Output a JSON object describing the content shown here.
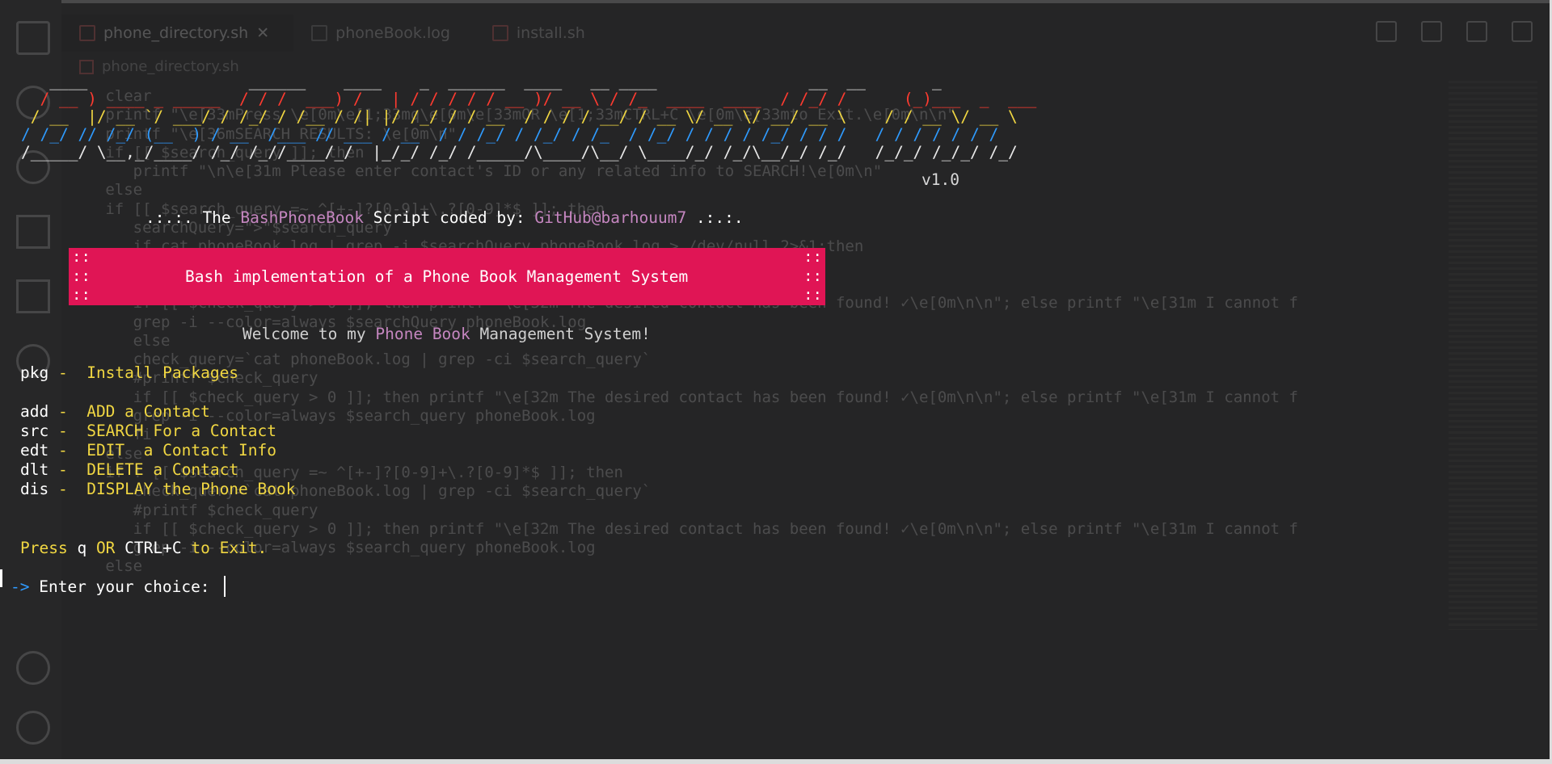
{
  "editor": {
    "tabs": [
      {
        "label": "phone_directory.sh",
        "close": "✕"
      },
      {
        "label": "phoneBook.log"
      },
      {
        "label": "install.sh"
      }
    ],
    "breadcrumb": "phone_directory.sh",
    "code_lines": [
      {
        "n": "",
        "t": "   clear"
      },
      {
        "n": "",
        "t": "   printf \"\\e[33mPress \\e[0m\\e[1;33mq\\e[0m\\e[33mOR \\e[1;33mCTRL+C \\e[0m\\e[33mto Exit.\\e[0m\\n\\n\""
      },
      {
        "n": "",
        "t": "   printf \"\\e[36mSEARCH RESULTS: \\e[0m\\n\""
      },
      {
        "n": "",
        "t": "   if [[ $search_query ]]; then"
      },
      {
        "n": "",
        "t": "      printf \"\\n\\e[31m Please enter contact's ID or any related info to SEARCH!\\e[0m\\n\""
      },
      {
        "n": "",
        "t": "   else"
      },
      {
        "n": "",
        "t": "   if [[ $search_query =~ ^[+-]?[0-9]+\\.?[0-9]*$ ]]; then"
      },
      {
        "n": "",
        "t": "      searchQuery=\">\"$search_query"
      },
      {
        "n": "",
        "t": "      if cat phoneBook.log | grep -i $searchQuery phoneBook.log > /dev/null 2>&1;then"
      },
      {
        "n": "",
        "t": "      check_query=`cat phoneBook.log | grep -ci $searchQuery`"
      },
      {
        "n": "",
        "t": "      #printf $check_query"
      },
      {
        "n": "",
        "t": ""
      },
      {
        "n": "",
        "t": "      if [[ $check_query > 0 ]]; then printf \"\\e[32m The desired contact has been found! ✓\\e[0m\\n\\n\"; else printf \"\\e[31m I cannot f"
      },
      {
        "n": "",
        "t": "      grep -i --color=always $searchQuery phoneBook.log"
      },
      {
        "n": "",
        "t": "      else"
      },
      {
        "n": "",
        "t": "      check_query=`cat phoneBook.log | grep -ci $search_query`"
      },
      {
        "n": "",
        "t": "      #printf $check_query"
      },
      {
        "n": "",
        "t": ""
      },
      {
        "n": "",
        "t": "      if [[ $check_query > 0 ]]; then printf \"\\e[32m The desired contact has been found! ✓\\e[0m\\n\\n\"; else printf \"\\e[31m I cannot f"
      },
      {
        "n": "",
        "t": "      grep -i --color=always $search_query phoneBook.log"
      },
      {
        "n": "",
        "t": "      fi"
      },
      {
        "n": "",
        "t": "   else"
      },
      {
        "n": "",
        "t": "   if ! [[ $search_query =~ ^[+-]?[0-9]+\\.?[0-9]*$ ]]; then"
      },
      {
        "n": "",
        "t": "      check_query=`cat phoneBook.log | grep -ci $search_query`"
      },
      {
        "n": "",
        "t": "      #printf $check_query"
      },
      {
        "n": "",
        "t": ""
      },
      {
        "n": "",
        "t": "      if [[ $check_query > 0 ]]; then printf \"\\e[32m The desired contact has been found! ✓\\e[0m\\n\\n\"; else printf \"\\e[31m I cannot f"
      },
      {
        "n": "",
        "t": "      grep -i --color=always $search_query phoneBook.log"
      },
      {
        "n": "",
        "t": "   else"
      }
    ]
  },
  "terminal": {
    "banner": [
      "   ____                 ______    ____    _  ______  ____   __ ____                __  __       _",
      "  / __ ) ____ _ _____  / / /  ___) /   | / / / / / __ )/ __ \\ / /_  ____  ____  / /_/ /      (_)___  _  ___",
      " / __  |/ __ `/ ___/ / /_/ / /__ / /| |/ /_/ / / __  / / / / __/ / __ \\/ __ \\/ __/ __ \\    / / __ \\/ __ \\",
      "/ /_/ // /_/ (__  ) / __  /___ // ___ / __  / / /_/ / /_/ / /_  / /_/ / / / / /_/ / / /   / / / / / / /",
      "/_____/ \\__,_/____/ /_/ /_//____/_/  |_/_/ /_/ /_____/\\____/\\__/ \\____/_/ /_/\\__/_/ /_/   /_/_/ /_/_/ /_/"
    ],
    "version": "v1.0",
    "credit": {
      "pre": ".:.:. The ",
      "name": "BashPhoneBook",
      "mid": " Script coded by: ",
      "author": "GitHub@barhouum7",
      "post": " .:.:."
    },
    "box": {
      "colons": "::\n::\n::",
      "title": "Bash implementation of a Phone Book Management System"
    },
    "welcome": {
      "pre": "Welcome to my ",
      "hl": "Phone Book",
      "post": " Management System!"
    },
    "menu": [
      {
        "key": "pkg",
        "sep": " -  ",
        "label": "Install Packages"
      },
      {
        "key": "add",
        "sep": " -  ",
        "label": "ADD a Contact"
      },
      {
        "key": "src",
        "sep": " -  ",
        "label": "SEARCH For a Contact"
      },
      {
        "key": "edt",
        "sep": " -  ",
        "label": "EDIT  a Contact Info"
      },
      {
        "key": "dlt",
        "sep": " -  ",
        "label": "DELETE a Contact"
      },
      {
        "key": "dis",
        "sep": " -  ",
        "label": "DISPLAY the Phone Book"
      }
    ],
    "exit": {
      "a": "Press ",
      "q": "q",
      "b": " OR ",
      "ctrl": "CTRL+C",
      "c": " to Exit."
    },
    "prompt": {
      "arrow": "->",
      "text": " Enter your choice: "
    }
  }
}
